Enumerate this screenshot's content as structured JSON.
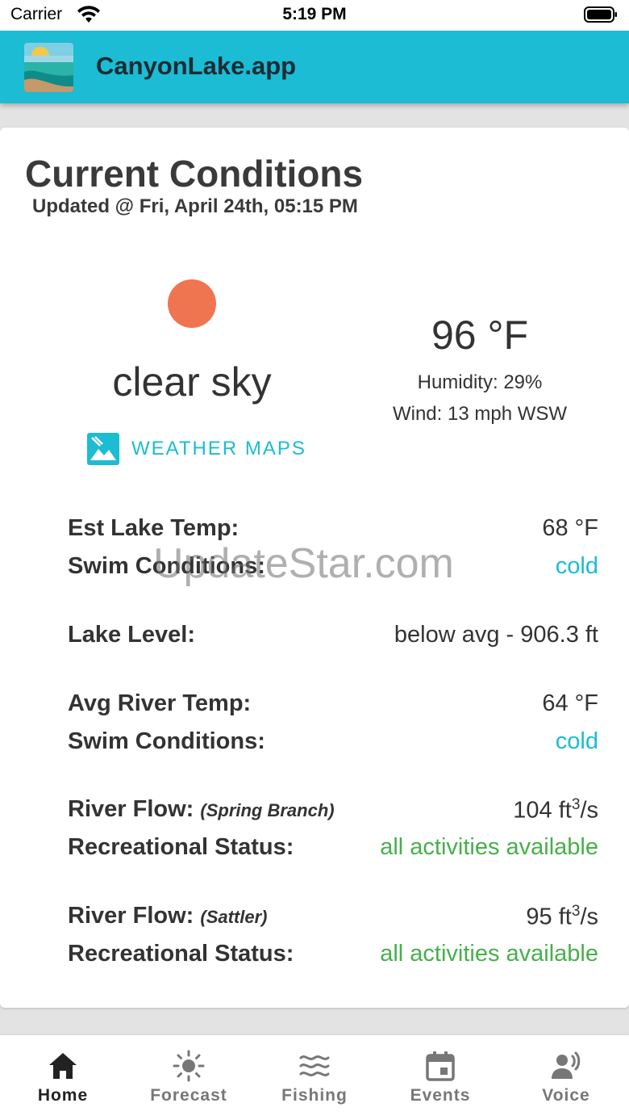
{
  "status_bar": {
    "carrier": "Carrier",
    "time": "5:19 PM"
  },
  "app": {
    "title": "CanyonLake.app"
  },
  "conditions": {
    "title": "Current Conditions",
    "updated": "Updated @ Fri, April 24th, 05:15 PM",
    "sky": "clear sky",
    "weather_maps_label": "WEATHER MAPS",
    "temperature": "96 °F",
    "humidity": "Humidity: 29%",
    "wind": "Wind: 13 mph WSW"
  },
  "details": {
    "lake_temp_label": "Est Lake Temp:",
    "lake_temp_value": "68 °F",
    "lake_swim_label": "Swim Conditions:",
    "lake_swim_value": "cold",
    "lake_level_label": "Lake Level:",
    "lake_level_value": "below avg - 906.3 ft",
    "river_temp_label": "Avg River Temp:",
    "river_temp_value": "64 °F",
    "river_swim_label": "Swim Conditions:",
    "river_swim_value": "cold",
    "flow1_label": "River Flow:",
    "flow1_site": "(Spring Branch)",
    "flow1_value": "104 ft",
    "flow1_exp": "3",
    "flow1_unit": "/s",
    "flow1_status_label": "Recreational Status:",
    "flow1_status_value": "all activities available",
    "flow2_label": "River Flow:",
    "flow2_site": "(Sattler)",
    "flow2_value": "95 ft",
    "flow2_exp": "3",
    "flow2_unit": "/s",
    "flow2_status_label": "Recreational Status:",
    "flow2_status_value": "all activities available"
  },
  "watermark": "UpdateStar.com",
  "tabs": [
    {
      "label": "Home",
      "icon": "home-icon",
      "active": true
    },
    {
      "label": "Forecast",
      "icon": "sun-icon",
      "active": false
    },
    {
      "label": "Fishing",
      "icon": "waves-icon",
      "active": false
    },
    {
      "label": "Events",
      "icon": "calendar-icon",
      "active": false
    },
    {
      "label": "Voice",
      "icon": "voice-icon",
      "active": false
    }
  ],
  "colors": {
    "accent": "#1bbcd4",
    "sun": "#ef7450",
    "status_good": "#46b04a"
  }
}
